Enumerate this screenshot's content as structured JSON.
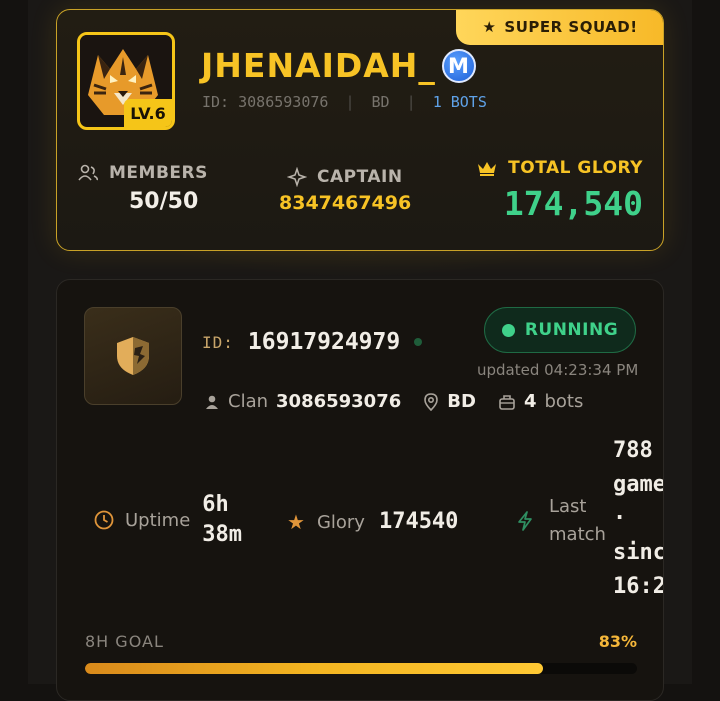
{
  "clan": {
    "badge": "SUPER SQUAD!",
    "level": "LV.6",
    "name": "JHENAIDAH_",
    "name_badge": "M",
    "id_label": "ID:",
    "id": "3086593076",
    "region": "BD",
    "bots": "1 BOTS",
    "members_label": "MEMBERS",
    "members_value": "50/50",
    "captain_label": "CAPTAIN",
    "captain_value": "8347467496",
    "glory_label": "TOTAL GLORY",
    "glory_value": "174,540"
  },
  "server": {
    "id_label": "ID:",
    "id": "16917924979",
    "status": "RUNNING",
    "updated": "updated 04:23:34 PM",
    "clan_label": "Clan",
    "clan_id": "3086593076",
    "region": "BD",
    "bots_count": "4",
    "bots_label": "bots",
    "uptime_label": "Uptime",
    "uptime_value_1": "6h",
    "uptime_value_2": "38m",
    "glory_label": "Glory",
    "glory_value": "174540",
    "last_label_1": "Last",
    "last_label_2": "match",
    "games_text": "788\ngame\n·\nsinc\n16:2",
    "goal_label": "8H GOAL",
    "goal_pct": "83%",
    "goal_progress": 0.83
  },
  "colors": {
    "gold": "#f7c325",
    "green": "#3fd18a",
    "blue": "#5fa2e8"
  }
}
